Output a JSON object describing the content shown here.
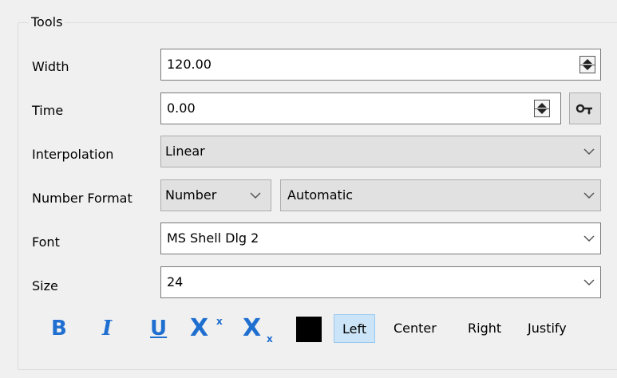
{
  "group": {
    "title": "Tools"
  },
  "width": {
    "label": "Width",
    "value": "120.00"
  },
  "time": {
    "label": "Time",
    "value": "0.00",
    "key_icon": "key-icon"
  },
  "interpolation": {
    "label": "Interpolation",
    "value": "Linear"
  },
  "number_format": {
    "label": "Number Format",
    "type": "Number",
    "mode": "Automatic"
  },
  "font": {
    "label": "Font",
    "value": "MS Shell Dlg 2"
  },
  "size": {
    "label": "Size",
    "value": "24"
  },
  "format": {
    "bold": "B",
    "italic": "I",
    "underline": "U",
    "superscript_base": "X",
    "superscript_mark": "x",
    "subscript_base": "X",
    "subscript_mark": "x",
    "color": "#000000"
  },
  "align": {
    "left": "Left",
    "center": "Center",
    "right": "Right",
    "justify": "Justify",
    "selected": "Left"
  },
  "colors": {
    "accent": "#1f6fd0",
    "selection": "#cce4f7"
  }
}
